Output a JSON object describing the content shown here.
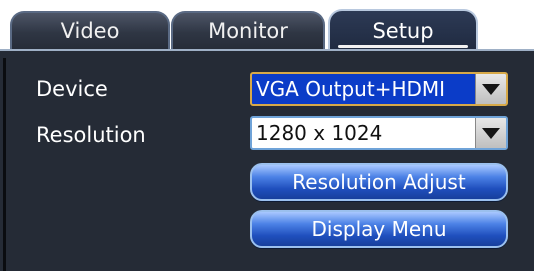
{
  "tabs": [
    {
      "label": "Video",
      "active": false
    },
    {
      "label": "Monitor",
      "active": false
    },
    {
      "label": "Setup",
      "active": true
    }
  ],
  "window_controls": {
    "minimize_label": "—",
    "close_label": "✕"
  },
  "form": {
    "device": {
      "label": "Device",
      "value": "VGA Output+HDMI"
    },
    "resolution": {
      "label": "Resolution",
      "value": "1280 x 1024"
    }
  },
  "buttons": {
    "resolution_adjust_label": "Resolution Adjust",
    "display_menu_label": "Display Menu"
  },
  "colors": {
    "panel_bg": "#252b36",
    "device_select_bg": "#0b3cc8",
    "button_blue": "#1f4fbd",
    "tab_bg": "#2f3644"
  }
}
